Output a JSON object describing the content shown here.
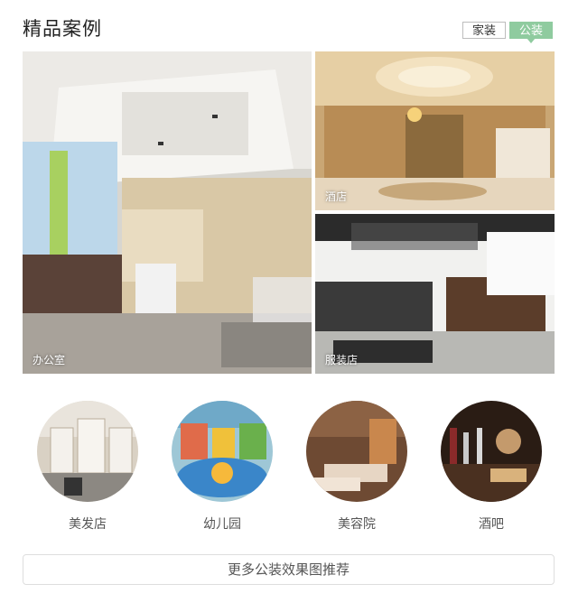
{
  "section_title": "精品案例",
  "tabs": {
    "home": "家装",
    "public": "公装"
  },
  "featured": {
    "office": "办公室",
    "hotel": "酒店",
    "clothing_store": "服装店"
  },
  "categories": [
    {
      "label": "美发店"
    },
    {
      "label": "幼儿园"
    },
    {
      "label": "美容院"
    },
    {
      "label": "酒吧"
    }
  ],
  "more_button": "更多公装效果图推荐",
  "colors": {
    "accent": "#8fcb9f"
  }
}
